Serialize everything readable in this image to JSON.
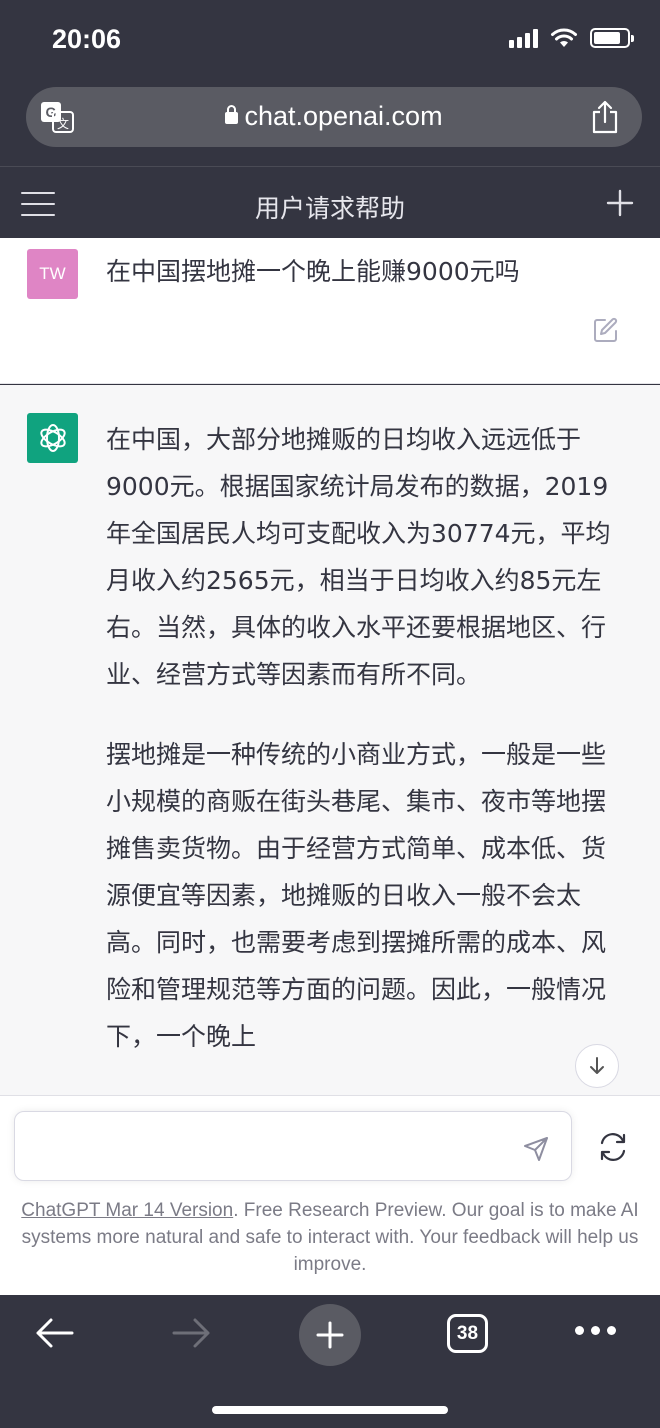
{
  "status_bar": {
    "time": "20:06"
  },
  "browser": {
    "url": "chat.openai.com",
    "tab_count": "38"
  },
  "app": {
    "title": "用户请求帮助"
  },
  "user_message": {
    "avatar_initials": "TW",
    "text": "在中国摆地摊一个晚上能赚9000元吗"
  },
  "assistant_message": {
    "paragraphs": [
      "在中国，大部分地摊贩的日均收入远远低于9000元。根据国家统计局发布的数据，2019年全国居民人均可支配收入为30774元，平均月收入约2565元，相当于日均收入约85元左右。当然，具体的收入水平还要根据地区、行业、经营方式等因素而有所不同。",
      "摆地摊是一种传统的小商业方式，一般是一些小规模的商贩在街头巷尾、集市、夜市等地摆摊售卖货物。由于经营方式简单、成本低、货源便宜等因素，地摊贩的日收入一般不会太高。同时，也需要考虑到摆摊所需的成本、风险和管理规范等方面的问题。因此，一般情况下，一个晚上"
    ]
  },
  "composer": {
    "placeholder": ""
  },
  "footer": {
    "version_link": "ChatGPT Mar 14 Version",
    "note": ". Free Research Preview. Our goal is to make AI systems more natural and safe to interact with. Your feedback will help us improve."
  },
  "colors": {
    "header_bg": "#343541",
    "user_avatar": "#df85c5",
    "bot_avatar": "#10a37f",
    "assistant_bg": "#f7f7f8"
  }
}
